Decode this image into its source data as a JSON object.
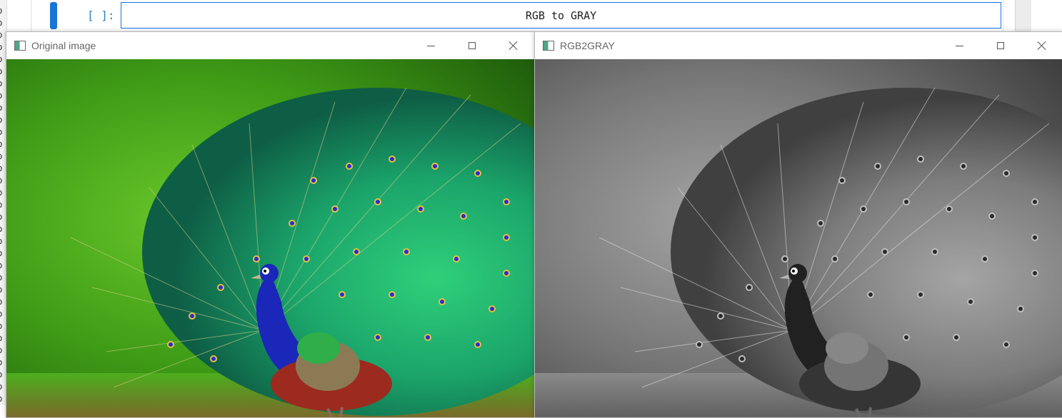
{
  "gutter": {
    "chars": [
      "o",
      "o",
      "o",
      "o",
      "o",
      "o",
      "o",
      "o",
      "o",
      "o",
      "o",
      "o",
      "o",
      "o",
      "o",
      "o",
      "o",
      "o",
      "o",
      "o",
      "o",
      "o",
      "o",
      "o",
      "o",
      "o",
      "o",
      "o",
      "o",
      "o",
      "o",
      "o",
      "o"
    ]
  },
  "notebook": {
    "cell": {
      "prompt": "[ ]:",
      "input_text": "RGB to GRAY"
    }
  },
  "windows": [
    {
      "title": "Original image",
      "image": "peacock-color"
    },
    {
      "title": "RGB2GRAY",
      "image": "peacock-grayscale"
    }
  ],
  "icons": {
    "app": "opencv-window-icon",
    "minimize": "minimize-icon",
    "maximize": "maximize-icon",
    "close": "close-icon"
  }
}
